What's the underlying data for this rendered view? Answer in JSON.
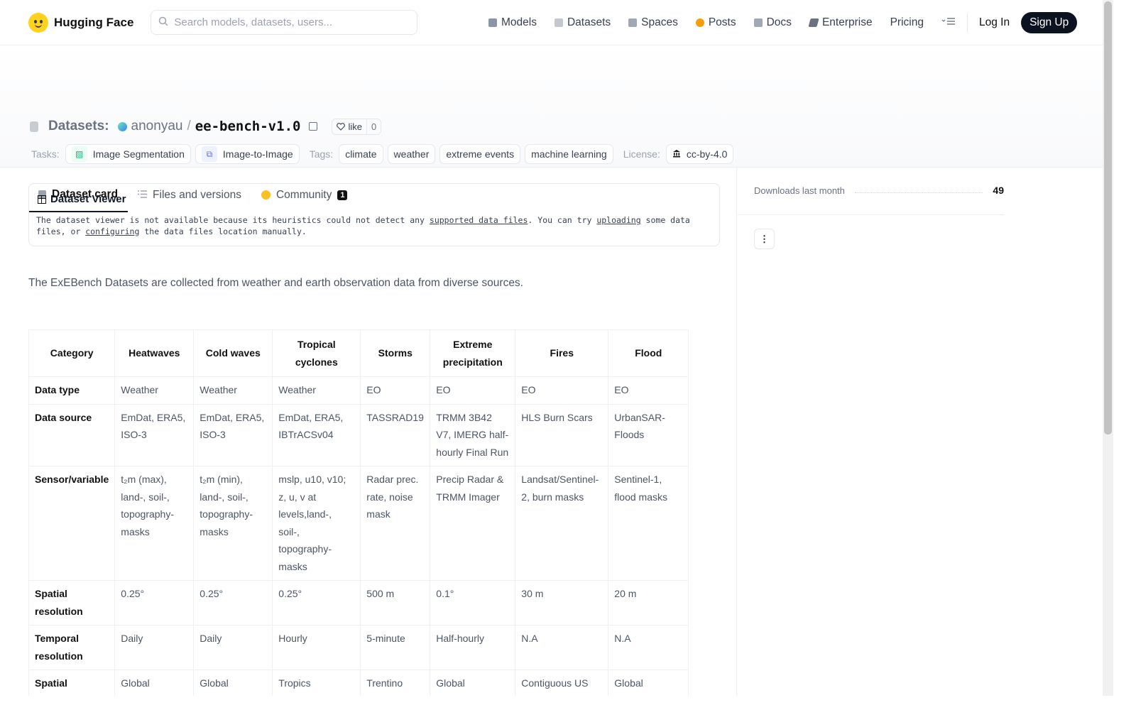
{
  "nav": {
    "brand": "Hugging Face",
    "search_placeholder": "Search models, datasets, users...",
    "links": [
      {
        "label": "Models",
        "icon": "models-icon",
        "color": "#8b95a7"
      },
      {
        "label": "Datasets",
        "icon": "datasets-icon",
        "color": "#c3c8d0"
      },
      {
        "label": "Spaces",
        "icon": "spaces-icon",
        "color": "#a1a8b5"
      },
      {
        "label": "Posts",
        "icon": "posts-icon",
        "color": "#f59e0b"
      },
      {
        "label": "Docs",
        "icon": "docs-icon",
        "color": "#a1a8b5"
      },
      {
        "label": "Enterprise",
        "icon": "enterprise-icon",
        "color": "#6b7280"
      },
      {
        "label": "Pricing",
        "icon": "",
        "color": ""
      }
    ],
    "login": "Log In",
    "signup": "Sign Up"
  },
  "repo": {
    "section": "Datasets:",
    "user": "anonyau",
    "slash": "/",
    "name": "ee-bench-v1.0",
    "like_label": "like",
    "like_count": "0"
  },
  "tags": {
    "tasks_label": "Tasks:",
    "tasks": [
      "Image Segmentation",
      "Image-to-Image"
    ],
    "tags_label": "Tags:",
    "tags": [
      "climate",
      "weather",
      "extreme events",
      "machine learning"
    ],
    "license_label": "License:",
    "license": "cc-by-4.0"
  },
  "tabs": [
    {
      "label": "Dataset card",
      "active": true
    },
    {
      "label": "Files and versions",
      "active": false
    },
    {
      "label": "Community",
      "active": false,
      "badge": "1"
    }
  ],
  "viewer": {
    "title": "Dataset Viewer",
    "text_1": "The dataset viewer is not available because its heuristics could not detect any ",
    "link_1": "supported data files",
    "text_2": ". You can try ",
    "link_2": "uploading",
    "text_3": " some data files, or ",
    "link_3": "configuring",
    "text_4": " the data files location manually."
  },
  "intro": "The ExEBench Datasets are collected from weather and earth observation data from diverse sources.",
  "table": {
    "columns": [
      "Category",
      "Heatwaves",
      "Cold waves",
      "Tropical cyclones",
      "Storms",
      "Extreme precipitation",
      "Fires",
      "Flood"
    ],
    "rows": [
      {
        "label": "Data type",
        "cells": [
          "Weather",
          "Weather",
          "Weather",
          "EO",
          "EO",
          "EO",
          "EO"
        ]
      },
      {
        "label": "Data source",
        "cells": [
          "EmDat, ERA5, ISO-3",
          "EmDat, ERA5, ISO-3",
          "EmDat, ERA5, IBTrACSv04",
          "TASSRAD19",
          "TRMM 3B42 V7, IMERG half-hourly Final Run",
          "HLS Burn Scars",
          "UrbanSAR-Floods"
        ]
      },
      {
        "label": "Sensor/variable",
        "cells": [
          "t₂m (max), land-, soil-, topography-masks",
          "t₂m (min), land-, soil-, topography-masks",
          "mslp, u10, v10; z, u, v at levels,land-, soil-, topography-masks",
          "Radar prec. rate, noise mask",
          "Precip Radar & TRMM Imager",
          "Landsat/Sentinel-2, burn masks",
          "Sentinel-1, flood masks"
        ]
      },
      {
        "label": "Spatial resolution",
        "cells": [
          "0.25°",
          "0.25°",
          "0.25°",
          "500 m",
          "0.1°",
          "30 m",
          "20 m"
        ]
      },
      {
        "label": "Temporal resolution",
        "cells": [
          "Daily",
          "Daily",
          "Hourly",
          "5-minute",
          "Half-hourly",
          "N.A",
          "N.A"
        ]
      },
      {
        "label": "Spatial coverage",
        "cells": [
          "Global",
          "Global",
          "Tropics",
          "Trentino South Tyrol",
          "Global",
          "Contiguous US",
          "Global"
        ]
      }
    ]
  },
  "side": {
    "downloads_label": "Downloads last month",
    "downloads_value": "49"
  }
}
